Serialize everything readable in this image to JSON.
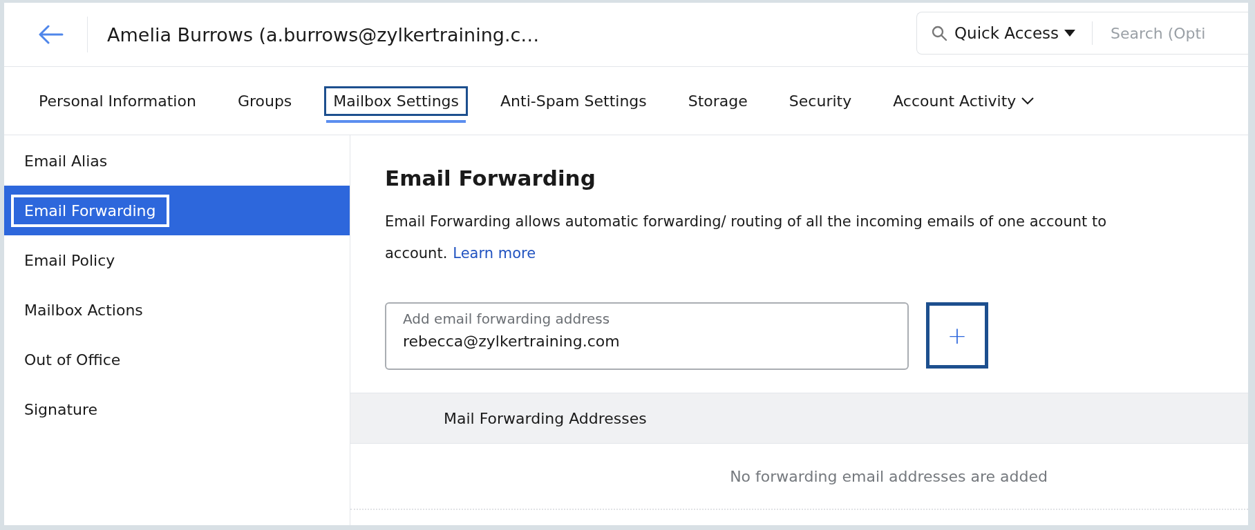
{
  "header": {
    "title": "Amelia Burrows (a.burrows@zylkertraining.c…",
    "quick_access": "Quick Access",
    "search": {
      "placeholder": "Search (Opti"
    }
  },
  "tabs": [
    {
      "label": "Personal Information",
      "selected": false,
      "dropdown": false
    },
    {
      "label": "Groups",
      "selected": false,
      "dropdown": false
    },
    {
      "label": "Mailbox Settings",
      "selected": true,
      "dropdown": false
    },
    {
      "label": "Anti-Spam Settings",
      "selected": false,
      "dropdown": false
    },
    {
      "label": "Storage",
      "selected": false,
      "dropdown": false
    },
    {
      "label": "Security",
      "selected": false,
      "dropdown": false
    },
    {
      "label": "Account Activity",
      "selected": false,
      "dropdown": true
    }
  ],
  "sidebar": {
    "items": [
      {
        "label": "Email Alias",
        "selected": false
      },
      {
        "label": "Email Forwarding",
        "selected": true
      },
      {
        "label": "Email Policy",
        "selected": false
      },
      {
        "label": "Mailbox Actions",
        "selected": false
      },
      {
        "label": "Out of Office",
        "selected": false
      },
      {
        "label": "Signature",
        "selected": false
      }
    ]
  },
  "content": {
    "heading": "Email Forwarding",
    "description_lines": [
      "Email Forwarding allows automatic forwarding/ routing of all the incoming emails of one account to",
      "account."
    ],
    "learn_more": "Learn more",
    "field": {
      "label": "Add email forwarding address",
      "value": "rebecca@zylkertraining.com"
    },
    "add_button": "+",
    "table": {
      "columns": [
        "Mail Forwarding Addresses"
      ],
      "empty_message": "No forwarding email addresses are added"
    }
  }
}
